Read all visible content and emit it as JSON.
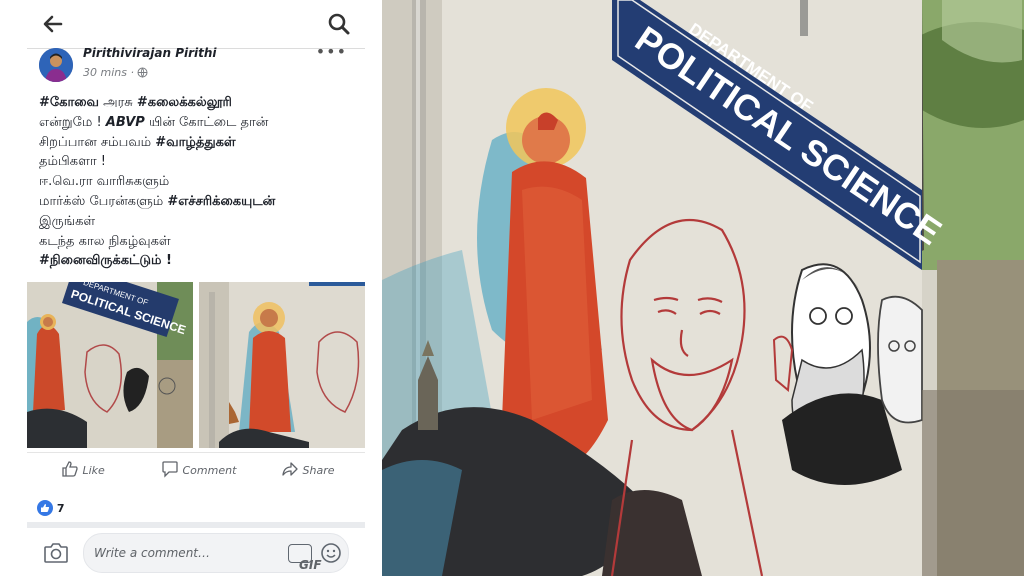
{
  "topbar": {
    "back_icon": "arrow-left-icon",
    "search_icon": "search-icon"
  },
  "post": {
    "author": "Pirithivirajan Pirithi",
    "time": "30 mins · ",
    "privacy_icon": "globe-icon",
    "lines": [
      [
        "#கோவை",
        " அரசு ",
        "#கலைக்கல்லூரி"
      ],
      [
        "என்றுமே ! ",
        "ABVP",
        " யின் கோட்டை தான்"
      ],
      [
        "சிறப்பான சம்பவம் ",
        "#வாழ்த்துகள்"
      ],
      [
        "தம்பிகளா !"
      ],
      [
        "ஈ.வெ.ரா வாரிசுகளும்"
      ],
      [
        "மார்க்ஸ் பேரன்களும் ",
        "#எச்சரிக்கையுடன்"
      ],
      [
        "இருங்கள்"
      ],
      [
        "கடந்த கால நிகழ்வுகள்"
      ],
      [
        "#நினைவிருக்கட்டும்",
        " !"
      ]
    ]
  },
  "photo_sign": {
    "line1": "DEPARTMENT OF",
    "line2": "POLITICAL SCIENCE"
  },
  "actions": {
    "like": "Like",
    "comment": "Comment",
    "share": "Share"
  },
  "reactions": {
    "count": "7"
  },
  "composer": {
    "placeholder": "Write a comment…",
    "gif": "GIF"
  }
}
